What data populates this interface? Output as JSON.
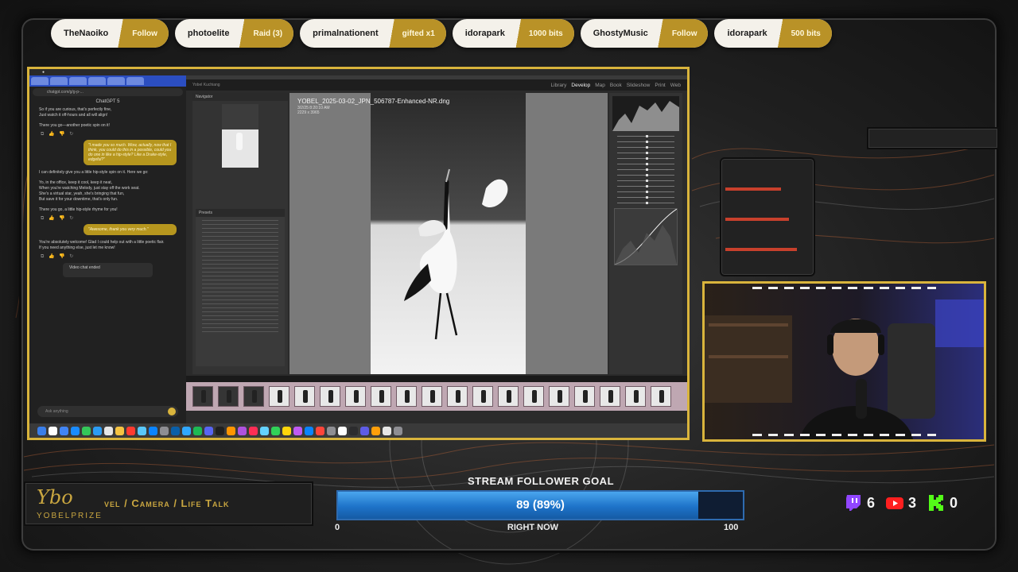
{
  "alerts": [
    {
      "name": "TheNaoiko",
      "action": "Follow"
    },
    {
      "name": "photoelite",
      "action": "Raid (3)"
    },
    {
      "name": "primalnationent",
      "action": "gifted x1"
    },
    {
      "name": "idorapark",
      "action": "1000 bits"
    },
    {
      "name": "GhostyMusic",
      "action": "Follow"
    },
    {
      "name": "idorapark",
      "action": "500 bits"
    }
  ],
  "chat": {
    "title": "ChatGPT 5",
    "url": "chatgpt.com/g/g-p-...",
    "messages": [
      {
        "role": "assistant",
        "lines": [
          "So if you are curious, that's perfectly fine,",
          "Just watch it off-hours and all will align!",
          "",
          "There you go—another poetic spin on it!"
        ]
      },
      {
        "role": "user",
        "text": "\"I made you so much. Wow, actually, now that I think, you could do this in a possible, could you do one in like a hip-style? Like a Drake-style, edgeful?\""
      },
      {
        "role": "assistant",
        "lines": [
          "I can definitely give you a little hip-style spin on it. Here we go:",
          "",
          "Yo, in the office, keep it cool, keep it neat,",
          "When you're watching Melody, just stay off the work seat.",
          "She's a virtual star, yeah, she's bringing that fun,",
          "But save it for your downtime, that's only fun.",
          "",
          "There you go, a little hip-style rhyme for you!"
        ]
      },
      {
        "role": "user",
        "text": "\"Awesome, thank you very much.\""
      },
      {
        "role": "assistant",
        "lines": [
          "You're absolutely welcome! Glad I could help out with a little poetic flair.",
          "If you need anything else, just let me know!"
        ]
      }
    ],
    "video_chat": "Video chat ended",
    "input_placeholder": "Ask anything"
  },
  "lightroom": {
    "brand": "Yobel Kuchiang",
    "modules": [
      "Library",
      "Develop",
      "Map",
      "Book",
      "Slideshow",
      "Print",
      "Web"
    ],
    "active_module": "Develop",
    "navigator_label": "Navigator",
    "presets_label": "Presets",
    "filename": "YOBEL_2025-03-02_JPN_506787-Enhanced-NR.dng",
    "meta_date": "3/2/25 8:20:10 AM",
    "meta_size": "2229 x 3965"
  },
  "goal": {
    "title": "STREAM FOLLOWER GOAL",
    "value_text": "89 (89%)",
    "progress": 0.89,
    "min": "0",
    "max": "100",
    "caption": "RIGHT NOW"
  },
  "brand": {
    "logo": "Ybo",
    "name": "YOBELPRIZE",
    "tagline": "vel / Camera / Life Talk"
  },
  "counts": [
    {
      "platform": "twitch-icon",
      "color": "#9146ff",
      "value": "6"
    },
    {
      "platform": "youtube-icon",
      "color": "#ff1f1f",
      "value": "3"
    },
    {
      "platform": "kick-icon",
      "color": "#53fc18",
      "value": "0"
    }
  ]
}
